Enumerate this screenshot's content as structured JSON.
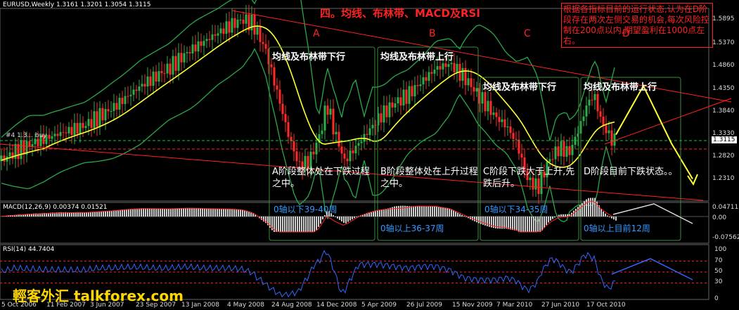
{
  "main_header": "EURUSD,Weekly  1.3161 1.3201 1.3054 1.3115",
  "section_title": "四。均线、布林带、MACD及RSI",
  "summary_note": "根据各指标目前的运行状态,认为在D阶段存在两次左侧交易的机会,每次风险控制在200点以内,期望盈利在1000点左右。",
  "watermark": "輕客外汇 talkforex.com",
  "buy_label": "#4 1.3... buy",
  "price_axis": [
    "1.5895",
    "1.5370",
    "1.4860",
    "1.4350",
    "1.3840",
    "1.3330",
    "1.2820",
    "1.2310"
  ],
  "price_current": "1.3115",
  "macd_header": "MACD(12,26,9) 0.00374 0.01521",
  "macd_axis": [
    "0.04711",
    "0.00",
    "-0.07562"
  ],
  "rsi_header": "RSI(14) 44.7404",
  "rsi_axis": [
    "100",
    "70",
    "50",
    "30",
    "0"
  ],
  "time_axis": [
    "5 Oct 2006",
    "11 Feb 2007",
    "3 Jun 2007",
    "23 Sep 2007",
    "13 Jan 2008",
    "4 May 2008",
    "24 Aug 2008",
    "14 Dec 2008",
    "5 Apr 2009",
    "26 Jul 2009",
    "15 Nov 2009",
    "7 Mar 2010",
    "27 Jun 2010",
    "17 Oct 2010"
  ],
  "phases": [
    {
      "letter": "A",
      "top": "均线及布林带下行",
      "bottom": "A阶段整体处在下跌过程之中。",
      "macd": "0轴以下39-40周"
    },
    {
      "letter": "B",
      "top": "均线及布林带上行",
      "bottom": "B阶段整体处在上升过程之中。",
      "macd": "0轴以上36-37周"
    },
    {
      "letter": "C",
      "top": "均线及布林带下行",
      "bottom": "C阶段下跌大于上升,先跌后升。",
      "macd": "0轴以下34-35周"
    },
    {
      "letter": "D",
      "top": "均线及布林带上行",
      "bottom": "D阶段目前下跌状态。。",
      "macd": "0轴以上目前12周"
    }
  ],
  "colors": {
    "bull": "#2db04a",
    "bear": "#ff2a2a",
    "ma": "#ffff33",
    "band": "#2aa84a",
    "rsi": "#3366ff",
    "annot": "#ff2222",
    "macd_text": "#3399ff",
    "box": "#3c8c3c"
  },
  "chart_data": {
    "type": "line",
    "title": "EURUSD,Weekly",
    "ylim": [
      1.18,
      1.615
    ],
    "price_path": [
      [
        0,
        1.27
      ],
      [
        20,
        1.29
      ],
      [
        45,
        1.31
      ],
      [
        80,
        1.33
      ],
      [
        120,
        1.35
      ],
      [
        160,
        1.39
      ],
      [
        200,
        1.44
      ],
      [
        240,
        1.48
      ],
      [
        270,
        1.52
      ],
      [
        300,
        1.55
      ],
      [
        325,
        1.575
      ],
      [
        345,
        1.59
      ],
      [
        360,
        1.58
      ],
      [
        378,
        1.52
      ],
      [
        395,
        1.42
      ],
      [
        410,
        1.33
      ],
      [
        425,
        1.26
      ],
      [
        440,
        1.27
      ],
      [
        455,
        1.33
      ],
      [
        465,
        1.4
      ],
      [
        475,
        1.34
      ],
      [
        490,
        1.27
      ],
      [
        505,
        1.3
      ],
      [
        520,
        1.33
      ],
      [
        540,
        1.37
      ],
      [
        560,
        1.4
      ],
      [
        580,
        1.42
      ],
      [
        600,
        1.45
      ],
      [
        620,
        1.48
      ],
      [
        640,
        1.49
      ],
      [
        660,
        1.46
      ],
      [
        675,
        1.43
      ],
      [
        690,
        1.4
      ],
      [
        705,
        1.37
      ],
      [
        720,
        1.35
      ],
      [
        735,
        1.31
      ],
      [
        750,
        1.23
      ],
      [
        765,
        1.21
      ],
      [
        780,
        1.27
      ],
      [
        795,
        1.3
      ],
      [
        810,
        1.29
      ],
      [
        825,
        1.35
      ],
      [
        835,
        1.4
      ],
      [
        845,
        1.42
      ],
      [
        855,
        1.36
      ],
      [
        865,
        1.33
      ],
      [
        876,
        1.31
      ]
    ],
    "projection": [
      [
        876,
        1.33
      ],
      [
        915,
        1.44
      ],
      [
        955,
        1.31
      ],
      [
        985,
        1.23
      ]
    ],
    "macd_hist_note": "histogram bars below/above zero per phase",
    "rsi_levels": [
      70,
      50,
      30
    ],
    "phase_ranges": [
      [
        "24 Aug 2008",
        "5 Apr 2009"
      ],
      [
        "5 Apr 2009",
        "15 Nov 2009"
      ],
      [
        "15 Nov 2009",
        "27 Jun 2010"
      ],
      [
        "27 Jun 2010",
        "17 Oct 2010"
      ]
    ]
  }
}
